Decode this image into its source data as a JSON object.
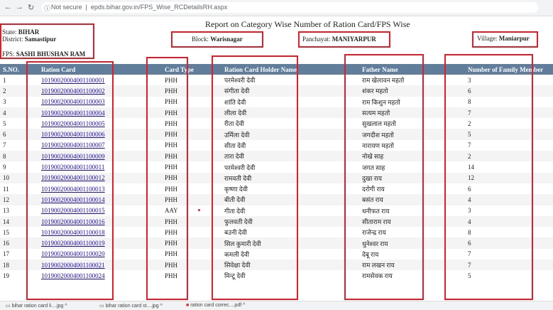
{
  "browser": {
    "back_icon": "←",
    "forward_icon": "→",
    "reload_icon": "↻",
    "security_text": "Not secure",
    "url": "epds.bihar.gov.in/FPS_Wise_RCDetailsRH.aspx"
  },
  "report": {
    "title": "Report on Category Wise Number of Ration Card/FPS Wise",
    "state_label": "State:",
    "state_value": "BIHAR",
    "district_label": "District:",
    "district_value": "Samastipur",
    "fps_label": "FPS:",
    "fps_value": "SASHI BHUSHAN RAM",
    "block_label": "Block:",
    "block_value": "Warisnagar",
    "panchayat_label": "Panchayat:",
    "panchayat_value": "MANIYARPUR",
    "village_label": "Village:",
    "village_value": "Maniarpur"
  },
  "table": {
    "headers": [
      "S.NO.",
      "Ration Card",
      "Card Type",
      "Ration Card Holder Name",
      "Father Name",
      "Number of Family Member"
    ],
    "rows": [
      [
        "1",
        "10190020004001100001",
        "PHH",
        "परमेश्वरी देवी",
        "राम खेलावन महतो",
        "3"
      ],
      [
        "2",
        "10190020004001100002",
        "PHH",
        "संगीता देवी",
        "शंकर महतो",
        "6"
      ],
      [
        "3",
        "10190020004001100003",
        "PHH",
        "शांति देवी",
        "राम किशुन महतो",
        "8"
      ],
      [
        "4",
        "10190020004001100004",
        "PHH",
        "लीला देवी",
        "सत्यम महतो",
        "7"
      ],
      [
        "5",
        "10190020004001100005",
        "PHH",
        "रीता देवी",
        "सुखलाल महतो",
        "2"
      ],
      [
        "6",
        "10190020004001100006",
        "PHH",
        "उर्मिला देवी",
        "जगदीश महतो",
        "5"
      ],
      [
        "7",
        "10190020004001100007",
        "PHH",
        "सीता देवी",
        "नारायण महतो",
        "7"
      ],
      [
        "8",
        "10190020004001100009",
        "PHH",
        "तारा देवी",
        "नोखे साह",
        "2"
      ],
      [
        "9",
        "10190020004001100011",
        "PHH",
        "परमेश्वरी देवी",
        "जगत साह",
        "14"
      ],
      [
        "10",
        "10190020004001100012",
        "PHH",
        "रामवती देवी",
        "दुखा राय",
        "12"
      ],
      [
        "11",
        "10190020004001100013",
        "PHH",
        "कृष्णा देवी",
        "दरोगी राय",
        "6"
      ],
      [
        "12",
        "10190020004001100014",
        "PHH",
        "बीती देवी",
        "बसंत राय",
        "4"
      ],
      [
        "13",
        "10190020004001100015",
        "AAY",
        "गीता देवी",
        "धनीफत राय",
        "3"
      ],
      [
        "14",
        "10190020004001100016",
        "PHH",
        "फुलवती देवी",
        "सीताराम राय",
        "4"
      ],
      [
        "15",
        "10190020004001100018",
        "PHH",
        "बउनी देवी",
        "राजेन्द्र राय",
        "8"
      ],
      [
        "16",
        "10190020004001100019",
        "PHH",
        "सिल कुमारी देवी",
        "धुनेश्वर राय",
        "6"
      ],
      [
        "17",
        "10190020004001100020",
        "PHH",
        "कमली देवी",
        "देबू राय",
        "7"
      ],
      [
        "18",
        "10190020004001100021",
        "PHH",
        "सिवेक्षा देवी",
        "राम लखन राय",
        "7"
      ],
      [
        "19",
        "10190020004001100024",
        "PHH",
        "मिन्टू देवी",
        "रामसेवक राय",
        "5"
      ]
    ]
  },
  "downloads": {
    "items": [
      "bihar ration card li....jpg",
      "bihar ration card st....jpg",
      "ration card correc....pdf"
    ]
  },
  "colors": {
    "header_bg": "#607d9c",
    "highlight_border": "#e21d2a",
    "link": "#1a0dab"
  }
}
